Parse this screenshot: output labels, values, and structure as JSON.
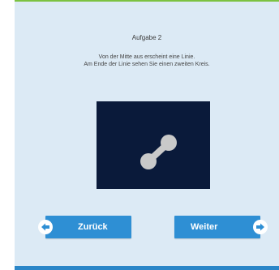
{
  "task": {
    "title": "Aufgabe 2",
    "line1": "Von der Mitte aus erscheint eine Linie.",
    "line2": "Am Ende der Linie sehen Sie einen zweiten Kreis."
  },
  "navigation": {
    "back_label": "Zurück",
    "next_label": "Weiter"
  },
  "icons": {
    "back": "arrow-left-icon",
    "next": "arrow-right-icon"
  },
  "colors": {
    "background": "#dceaf5",
    "accent": "#2e8fd4",
    "stage": "#0a1a3a",
    "top_bar": "#7cc241",
    "bottom_bar": "#2a86c8"
  }
}
